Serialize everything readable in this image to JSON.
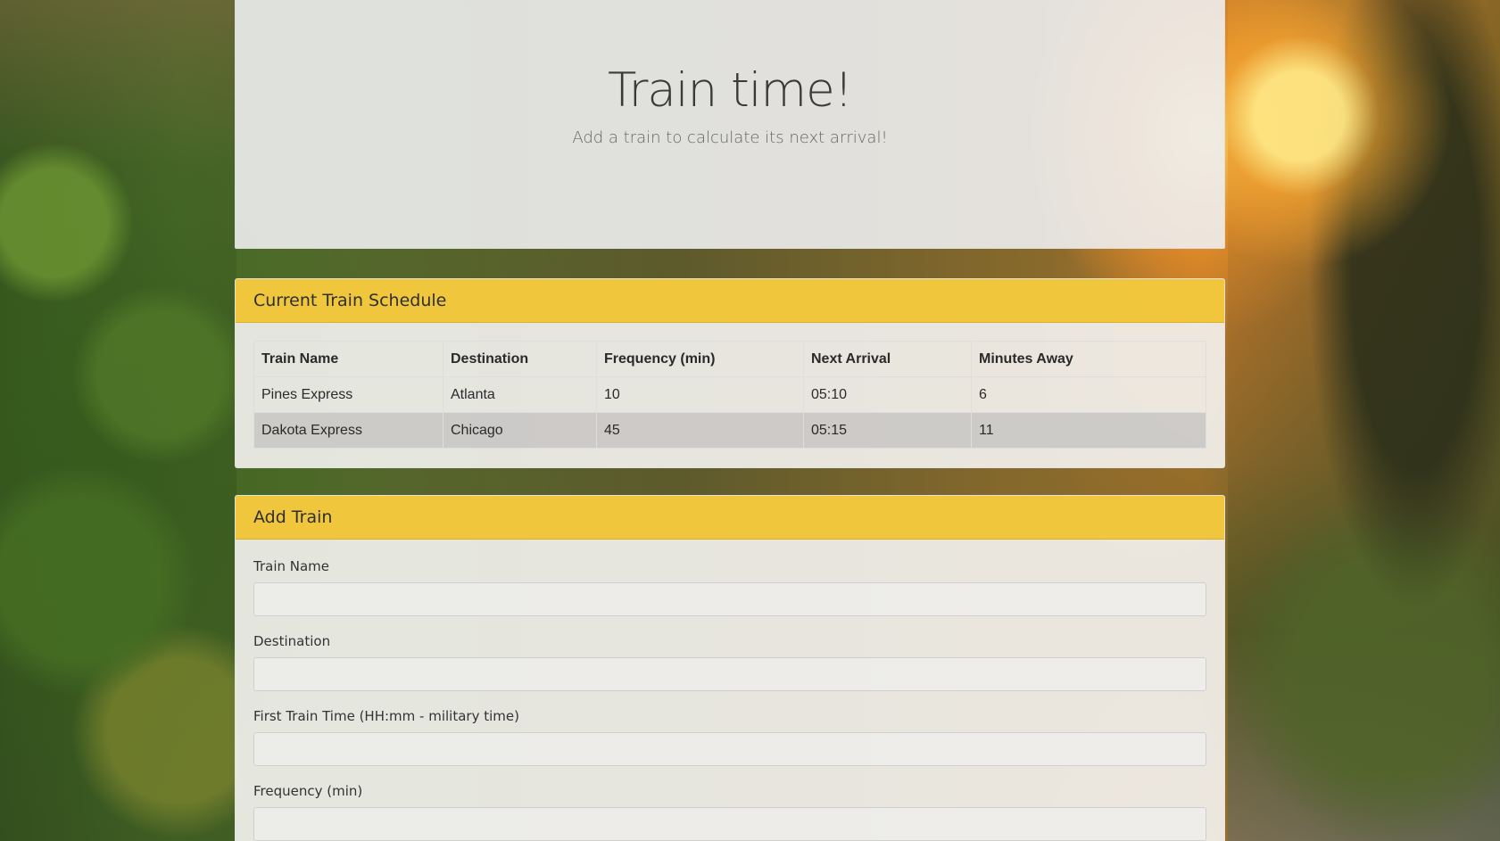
{
  "jumbotron": {
    "title": "Train time!",
    "subtitle": "Add a train to calculate its next arrival!"
  },
  "schedule": {
    "heading": "Current Train Schedule",
    "columns": [
      "Train Name",
      "Destination",
      "Frequency (min)",
      "Next Arrival",
      "Minutes Away"
    ],
    "rows": [
      [
        "Pines Express",
        "Atlanta",
        "10",
        "05:10",
        "6"
      ],
      [
        "Dakota Express",
        "Chicago",
        "45",
        "05:15",
        "11"
      ]
    ]
  },
  "add_train": {
    "heading": "Add Train",
    "fields": [
      {
        "label": "Train Name",
        "value": "",
        "placeholder": ""
      },
      {
        "label": "Destination",
        "value": "",
        "placeholder": ""
      },
      {
        "label": "First Train Time (HH:mm - military time)",
        "value": "",
        "placeholder": ""
      },
      {
        "label": "Frequency (min)",
        "value": "",
        "placeholder": ""
      }
    ]
  },
  "colors": {
    "header_accent": "#f0c434",
    "panel_bg": "#f5f4f2",
    "striped_row": "#c8c6c4"
  }
}
